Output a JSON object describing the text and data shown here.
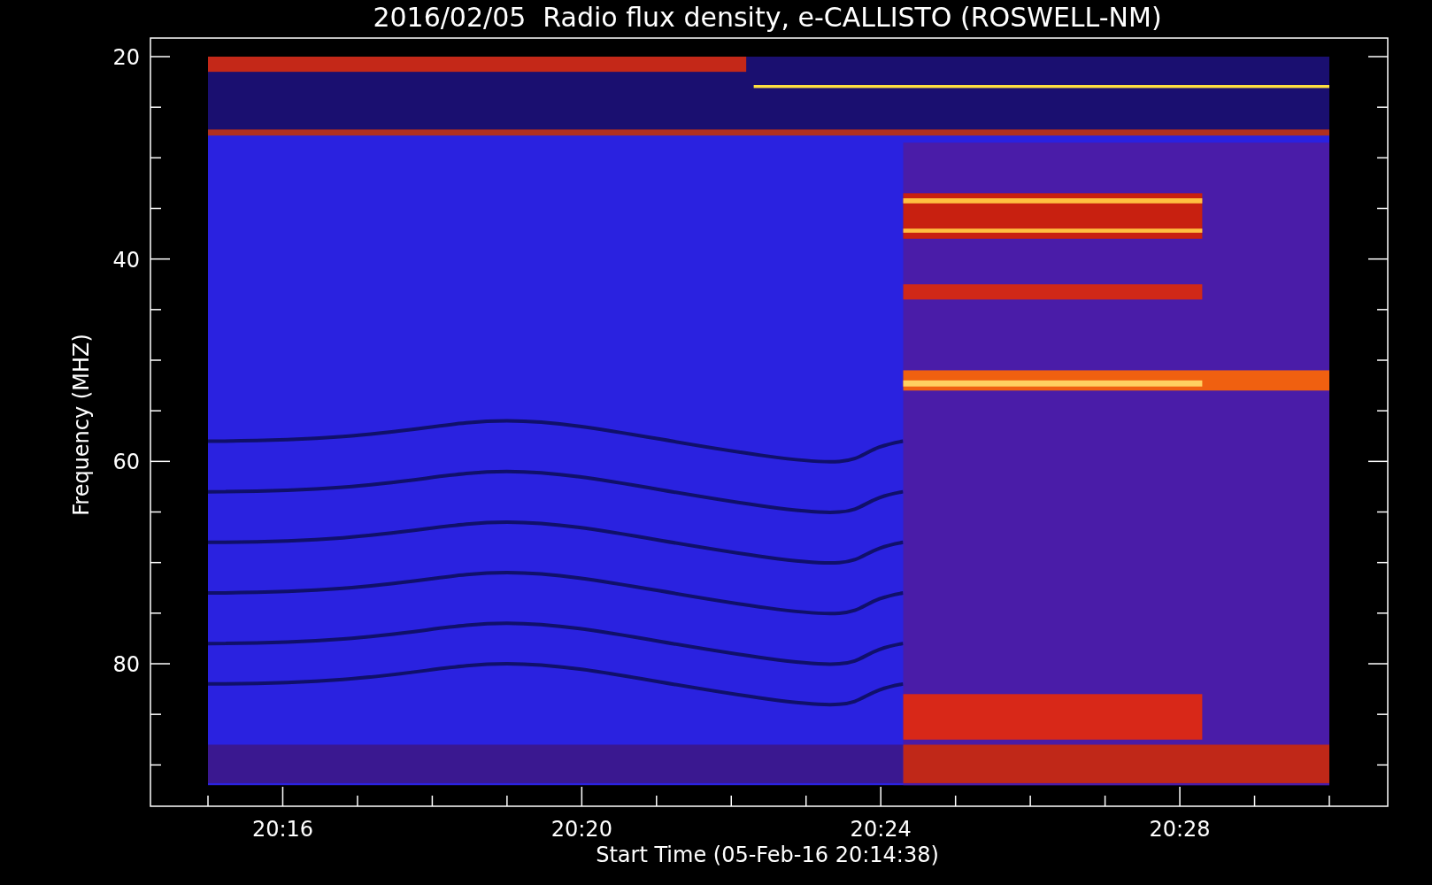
{
  "title": "2016/02/05  Radio flux density, e-CALLISTO (ROSWELL-NM)",
  "y_axis": {
    "label": "Frequency (MHZ)",
    "ticks": [
      "20",
      "40",
      "60",
      "80"
    ]
  },
  "x_axis": {
    "label": "Start Time (05-Feb-16 20:14:38)",
    "ticks": [
      "20:16",
      "20:20",
      "20:24",
      "20:28"
    ]
  }
}
